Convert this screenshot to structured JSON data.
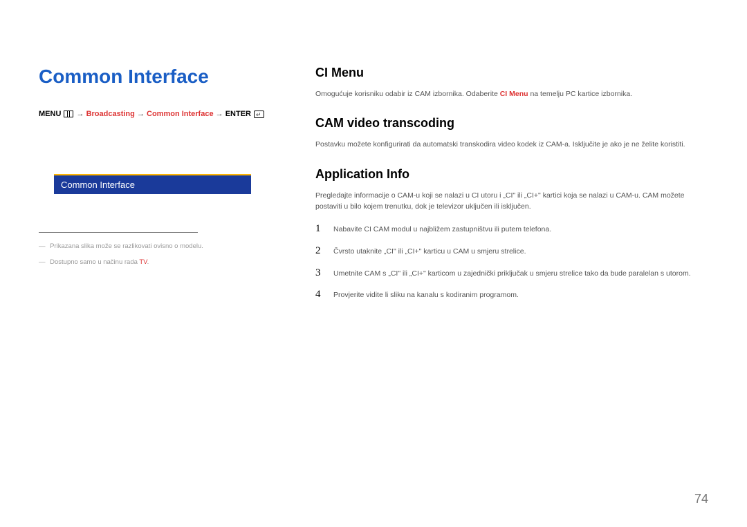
{
  "page_number": "74",
  "left": {
    "title": "Common Interface",
    "breadcrumb": {
      "prefix_bold": "MENU",
      "arrow": "→",
      "item1": "Broadcasting",
      "item2": "Common Interface",
      "suffix_bold": "ENTER"
    },
    "menu_header": "Common Interface",
    "notes": [
      "Prikazana slika može se razlikovati ovisno o modelu.",
      "Dostupno samo u načinu rada"
    ],
    "notes_tv": "TV"
  },
  "right": {
    "sections": [
      {
        "title": "CI Menu",
        "body_pre": "Omogućuje korisniku odabir iz CAM izbornika. Odaberite ",
        "body_hl": "CI Menu",
        "body_post": " na temelju PC kartice izbornika."
      },
      {
        "title": "CAM video transcoding",
        "body": "Postavku možete konfigurirati da automatski transkodira video kodek iz CAM-a. Isključite je ako je ne želite koristiti."
      },
      {
        "title": "Application Info",
        "body": "Pregledajte informacije o CAM-u koji se nalazi u CI utoru i „CI\" ili „CI+\" kartici koja se nalazi u CAM-u. CAM možete postaviti u bilo kojem trenutku, dok je televizor uključen ili isključen.",
        "steps": [
          "Nabavite CI CAM modul u najbližem zastupništvu ili putem telefona.",
          "Čvrsto utaknite „CI\" ili „CI+\" karticu u CAM u smjeru strelice.",
          "Umetnite CAM s „CI\" ili „CI+\" karticom u zajednički priključak u smjeru strelice tako da bude paralelan s utorom.",
          "Provjerite vidite li sliku na kanalu s kodiranim programom."
        ]
      }
    ]
  }
}
